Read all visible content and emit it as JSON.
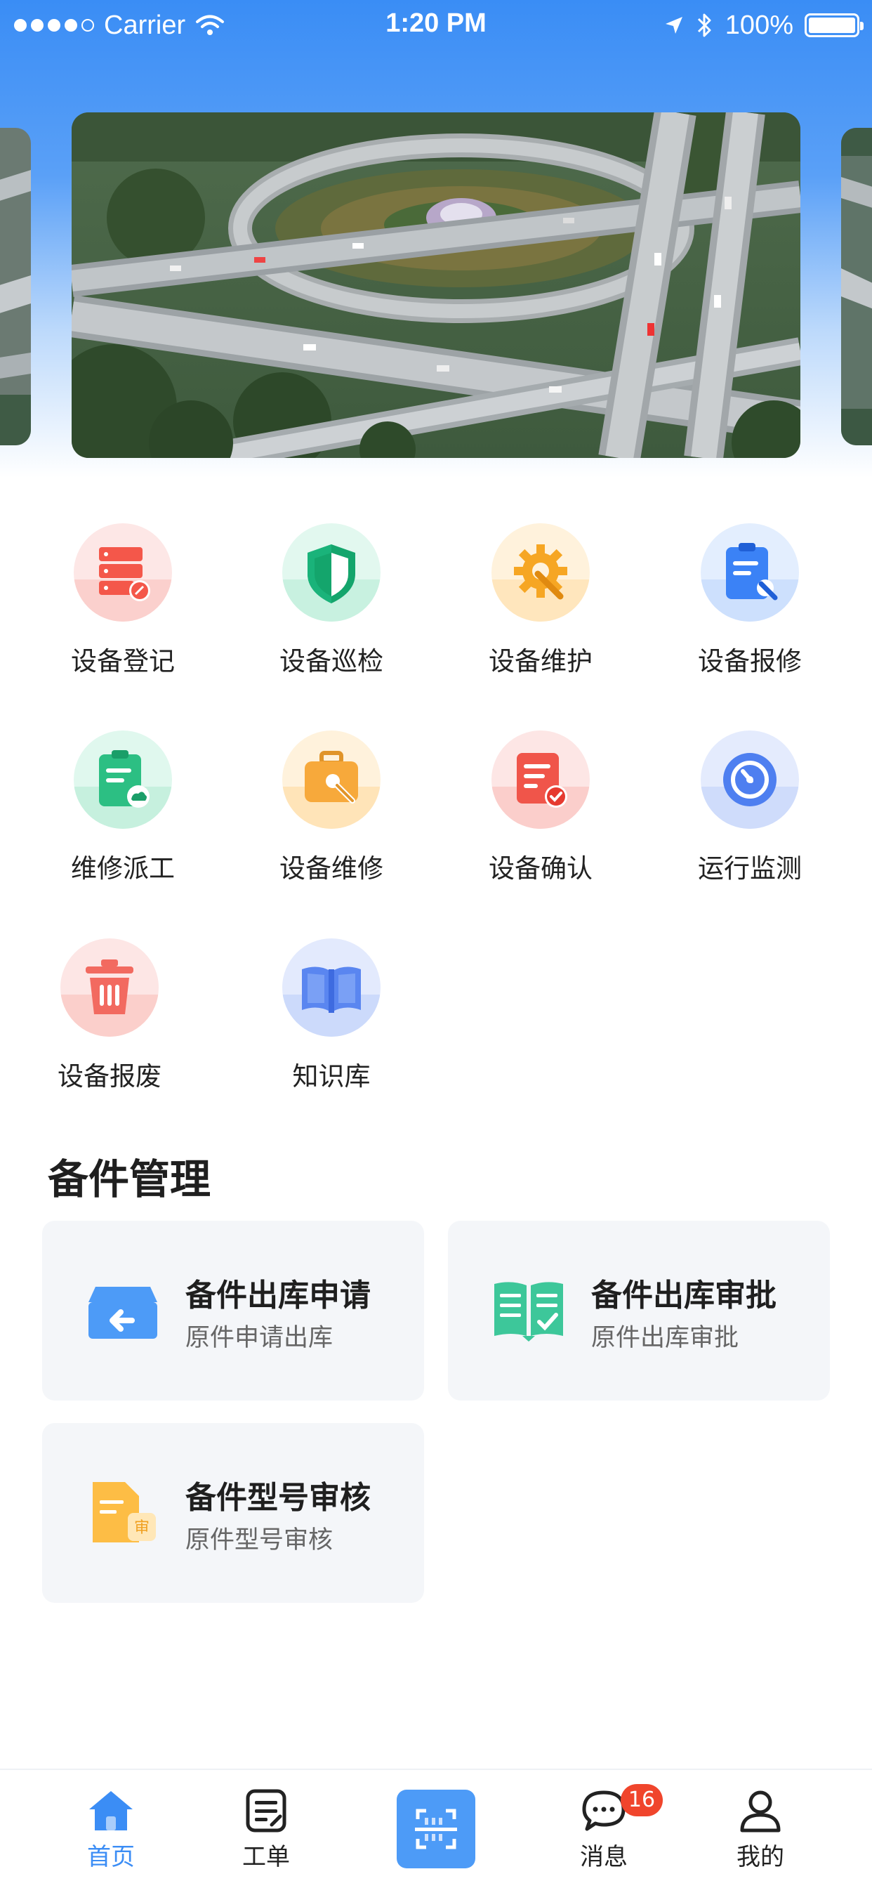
{
  "status_bar": {
    "carrier": "Carrier",
    "time": "1:20 PM",
    "battery": "100%"
  },
  "banner": {
    "image": "highway-interchange-photo"
  },
  "grid": [
    {
      "label": "设备登记",
      "icon": "server-register-icon",
      "color": "#f46b5c"
    },
    {
      "label": "设备巡检",
      "icon": "shield-icon",
      "color": "#1ab37a"
    },
    {
      "label": "设备维护",
      "icon": "gear-wrench-icon",
      "color": "#f6a623"
    },
    {
      "label": "设备报修",
      "icon": "clipboard-repair-icon",
      "color": "#3b82f6"
    },
    {
      "label": "维修派工",
      "icon": "clipboard-dispatch-icon",
      "color": "#2cbf83"
    },
    {
      "label": "设备维修",
      "icon": "toolbox-icon",
      "color": "#f7a93b"
    },
    {
      "label": "设备确认",
      "icon": "document-check-icon",
      "color": "#f0554a"
    },
    {
      "label": "运行监测",
      "icon": "gauge-icon",
      "color": "#4e7ff0"
    },
    {
      "label": "设备报废",
      "icon": "trash-icon",
      "color": "#f26a60"
    },
    {
      "label": "知识库",
      "icon": "book-icon",
      "color": "#5a86f0"
    }
  ],
  "section": {
    "title": "备件管理"
  },
  "cards": [
    {
      "title": "备件出库申请",
      "subtitle": "原件申请出库",
      "icon": "outbound-box-icon"
    },
    {
      "title": "备件出库审批",
      "subtitle": "原件出库审批",
      "icon": "approval-book-icon"
    },
    {
      "title": "备件型号审核",
      "subtitle": "原件型号审核",
      "icon": "document-review-icon",
      "icon_text": "审"
    }
  ],
  "tabbar": {
    "home": "首页",
    "orders": "工单",
    "messages": "消息",
    "messages_badge": "16",
    "mine": "我的",
    "active_color": "#3b8df5"
  }
}
